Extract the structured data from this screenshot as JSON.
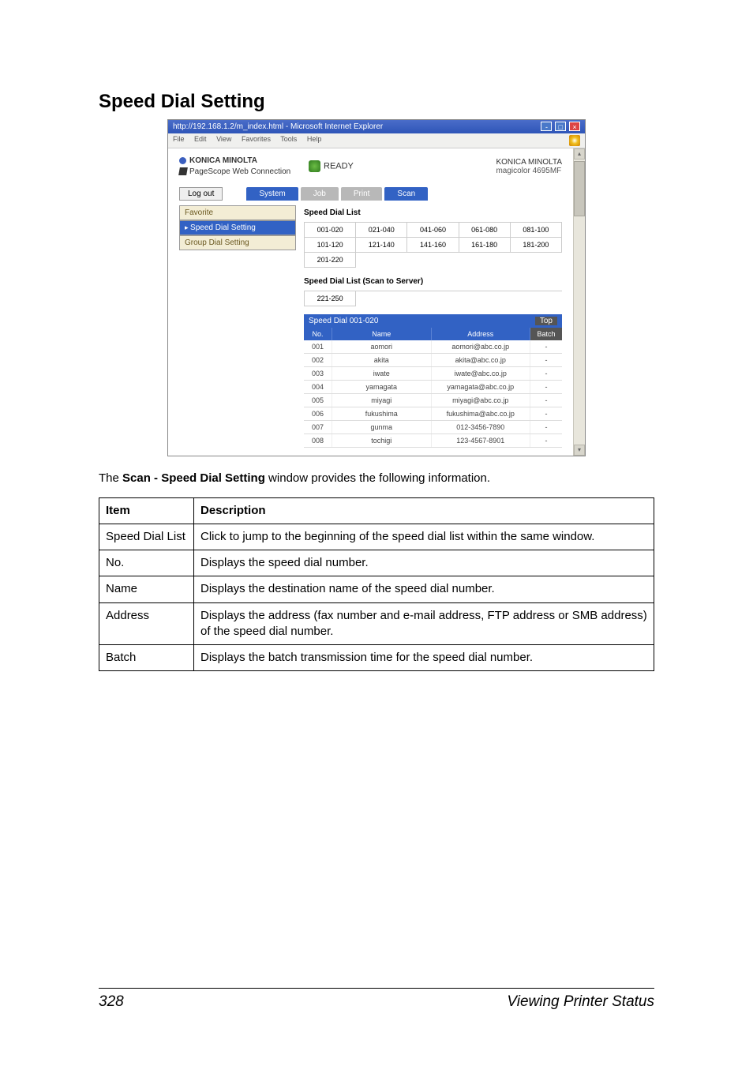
{
  "title": "Speed Dial Setting",
  "screenshot": {
    "window_title": "http://192.168.1.2/m_index.html - Microsoft Internet Explorer",
    "menus": [
      "File",
      "Edit",
      "View",
      "Favorites",
      "Tools",
      "Help"
    ],
    "brand": "KONICA MINOLTA",
    "brand_sub": "PageScope Web Connection",
    "ready": "READY",
    "device_brand": "KONICA MINOLTA",
    "device_model": "magicolor 4695MF",
    "logout": "Log out",
    "tabs": {
      "system": "System",
      "job": "Job",
      "print": "Print",
      "scan": "Scan"
    },
    "side": {
      "favorite": "Favorite",
      "speed": "Speed Dial Setting",
      "group": "Group Dial Setting"
    },
    "sdl_heading": "Speed Dial List",
    "ranges": [
      "001-020",
      "021-040",
      "041-060",
      "061-080",
      "081-100",
      "101-120",
      "121-140",
      "141-160",
      "161-180",
      "181-200",
      "201-220"
    ],
    "sts_heading": "Speed Dial List (Scan to Server)",
    "sts_range": "221-250",
    "list_title": "Speed Dial 001-020",
    "top": "Top",
    "cols": {
      "no": "No.",
      "name": "Name",
      "addr": "Address",
      "batch": "Batch"
    },
    "rows": [
      {
        "no": "001",
        "name": "aomori",
        "addr": "aomori@abc.co.jp",
        "batch": "-"
      },
      {
        "no": "002",
        "name": "akita",
        "addr": "akita@abc.co.jp",
        "batch": "-"
      },
      {
        "no": "003",
        "name": "iwate",
        "addr": "iwate@abc.co.jp",
        "batch": "-"
      },
      {
        "no": "004",
        "name": "yamagata",
        "addr": "yamagata@abc.co.jp",
        "batch": "-"
      },
      {
        "no": "005",
        "name": "miyagi",
        "addr": "miyagi@abc.co.jp",
        "batch": "-"
      },
      {
        "no": "006",
        "name": "fukushima",
        "addr": "fukushima@abc.co.jp",
        "batch": "-"
      },
      {
        "no": "007",
        "name": "gunma",
        "addr": "012-3456-7890",
        "batch": "-"
      },
      {
        "no": "008",
        "name": "tochigi",
        "addr": "123-4567-8901",
        "batch": "-"
      }
    ]
  },
  "caption_pre": "The ",
  "caption_bold": "Scan - Speed Dial Setting",
  "caption_post": " window provides the following information.",
  "table": {
    "h_item": "Item",
    "h_desc": "Description",
    "rows": [
      {
        "item": "Speed Dial List",
        "desc": "Click to jump to the beginning of the speed dial list within the same window."
      },
      {
        "item": "No.",
        "desc": "Displays the speed dial number."
      },
      {
        "item": "Name",
        "desc": "Displays the destination name of the speed dial number."
      },
      {
        "item": "Address",
        "desc": "Displays the address (fax number and e-mail address, FTP address or SMB address) of the speed dial number."
      },
      {
        "item": "Batch",
        "desc": "Displays the batch transmission time for the speed dial number."
      }
    ]
  },
  "footer": {
    "page": "328",
    "section": "Viewing Printer Status"
  }
}
